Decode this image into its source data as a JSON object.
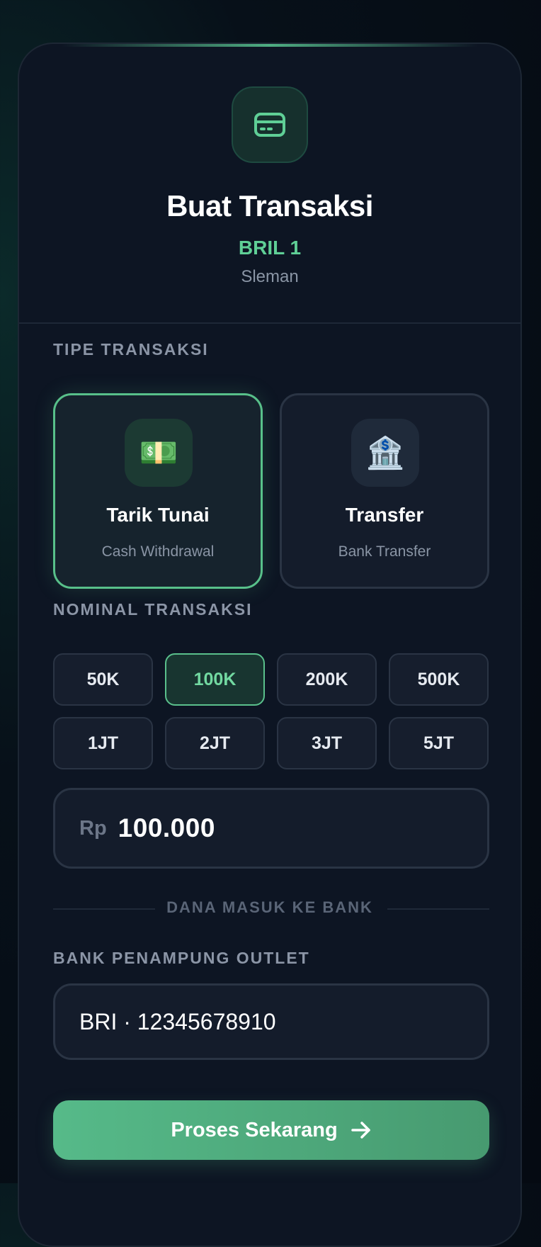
{
  "header": {
    "icon": "credit-card-icon",
    "title": "Buat Transaksi",
    "outlet_name": "BRIL 1",
    "location": "Sleman"
  },
  "transaction_type": {
    "label": "TIPE TRANSAKSI",
    "selected": "Tarik Tunai",
    "options": [
      {
        "icon": "💵",
        "icon_name": "banknote-icon",
        "name": "Tarik Tunai",
        "description": "Cash Withdrawal",
        "active": true
      },
      {
        "icon": "🏦",
        "icon_name": "bank-icon",
        "name": "Transfer",
        "description": "Bank Transfer",
        "active": false
      }
    ]
  },
  "nominal": {
    "label": "NOMINAL TRANSAKSI",
    "selected": "100K",
    "options": [
      "50K",
      "100K",
      "200K",
      "500K",
      "1JT",
      "2JT",
      "3JT",
      "5JT"
    ]
  },
  "amount": {
    "currency": "Rp",
    "value": "100.000"
  },
  "separator": {
    "text": "DANA MASUK KE BANK"
  },
  "bank": {
    "label": "BANK PENAMPUNG OUTLET",
    "value": "BRI · 12345678910"
  },
  "submit": {
    "label": "Proses Sekarang",
    "icon": "arrow-right-icon"
  },
  "colors": {
    "accent": "#5fcf96",
    "background": "#0d1523",
    "border": "#2a3444"
  }
}
